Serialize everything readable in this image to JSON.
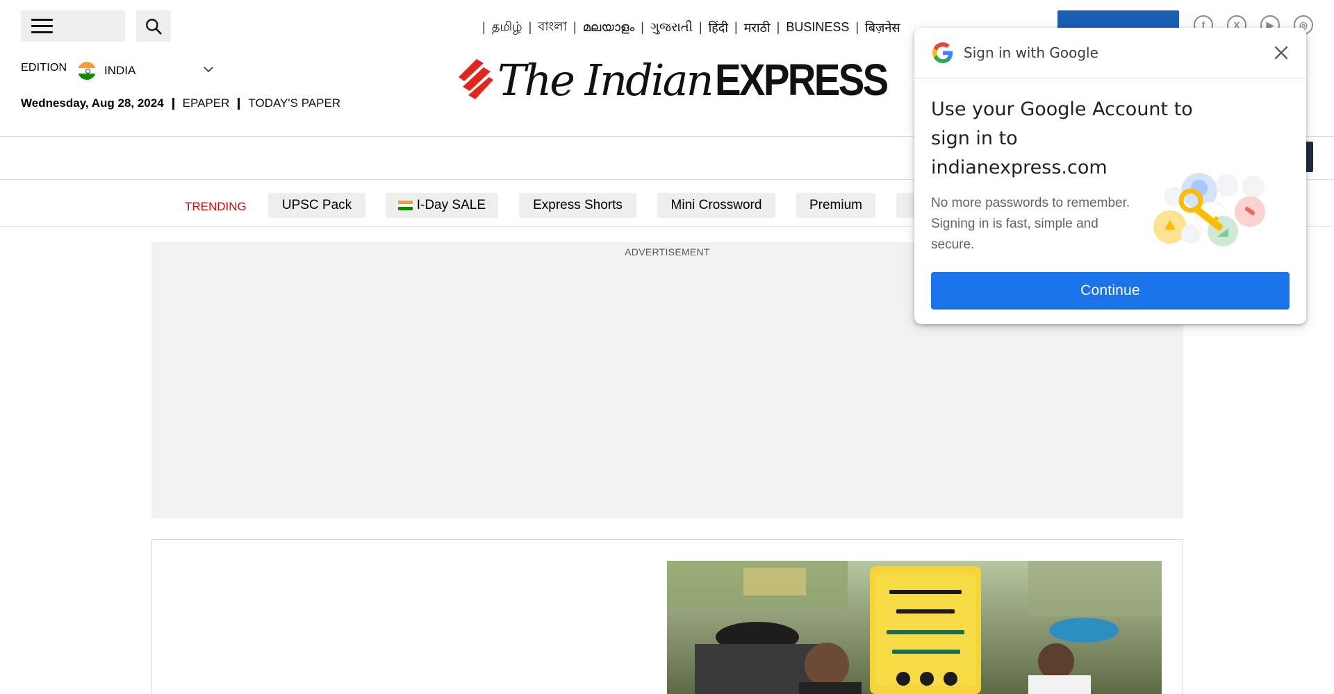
{
  "header": {
    "languages": [
      "தமிழ்",
      "বাংলা",
      "മലയാളം",
      "ગુજરાતી",
      "हिंदी",
      "मराठी",
      "BUSINESS",
      "बिज़नेस"
    ],
    "edition_label": "EDITION",
    "edition_country": "INDIA",
    "date": "Wednesday, Aug 28, 2024",
    "epaper": "EPAPER",
    "todays_paper": "TODAY'S PAPER",
    "logo_serif": "The Indian",
    "logo_bold": "EXPRESS"
  },
  "trending": {
    "label": "TRENDING",
    "chips": [
      "UPSC Pack",
      "I-Day SALE",
      "Express Shorts",
      "Mini Crossword",
      "Premium"
    ]
  },
  "ad": {
    "label": "ADVERTISEMENT"
  },
  "google_signin": {
    "header_title": "Sign in with Google",
    "title": "Use your Google Account to sign in to indianexpress.com",
    "body": "No more passwords to remember. Signing in is fast, simple and secure.",
    "continue_label": "Continue"
  },
  "colors": {
    "trending_red": "#d10a0a",
    "google_blue": "#1a73e8",
    "subscribe_blue": "#1a5fb4",
    "logo_red": "#e3261c"
  }
}
